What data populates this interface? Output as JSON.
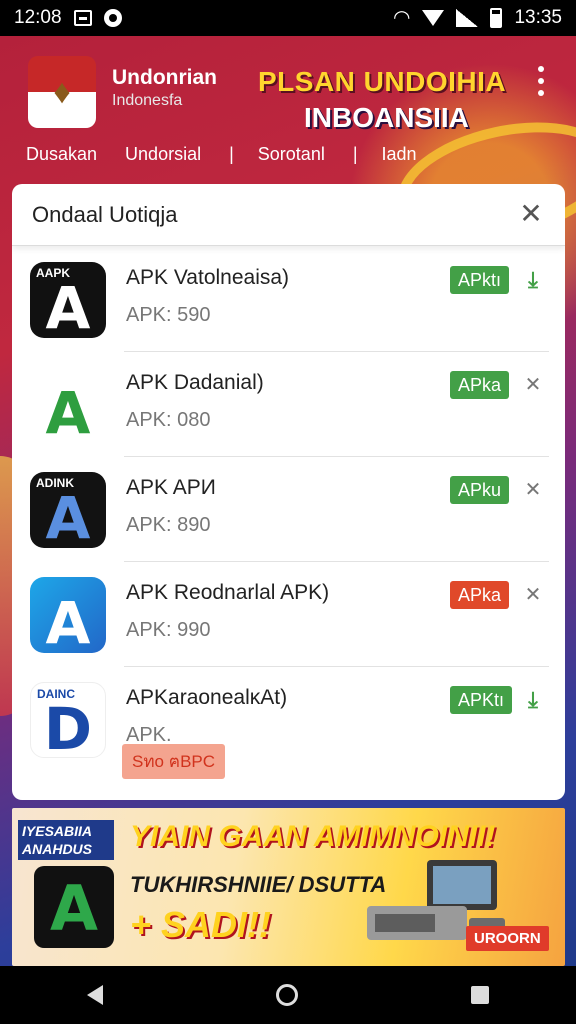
{
  "status_bar": {
    "time_left": "12:08",
    "time_right": "13:35"
  },
  "header": {
    "brand_name": "Undonrian",
    "brand_sub": "Indonesfa",
    "hero_title": "PLSAN UNDOIHIA",
    "hero_title2": "INBOANSIIA",
    "nav_tabs": [
      "Dusakan",
      "Undorsial",
      "Sorotanl",
      "Iadn"
    ],
    "nav_separator": "|"
  },
  "sheet": {
    "title": "Ondaal Uotiqja",
    "close_label": "✕",
    "items": [
      {
        "name": "APK Vatolneaisa)",
        "size": "APK: 590",
        "badge": "APktı",
        "badge_color": "#43a047",
        "action": "download-icon",
        "icon_tag": "AAPK"
      },
      {
        "name": "APK Dadanial)",
        "size": "APK: 080",
        "badge": "APka",
        "badge_color": "#43a047",
        "action": "x-icon",
        "icon_tag": ""
      },
      {
        "name": "APK APИ",
        "size": "APK: 890",
        "badge": "APku",
        "badge_color": "#43a047",
        "action": "x-icon",
        "icon_tag": "ADINK"
      },
      {
        "name": "APK Reodnarlal APK)",
        "size": "APK: 990",
        "badge": "APka",
        "badge_color": "#e0492a",
        "action": "x-icon",
        "icon_tag": ""
      },
      {
        "name": "APKaraonealκAt)",
        "size": "APK.",
        "badge": "APKtı",
        "badge_color": "#43a047",
        "action": "download-icon",
        "icon_tag": "DAINC",
        "chip": "Sทo ฅBPC"
      }
    ]
  },
  "banner": {
    "tag": "IYESABIIA ANAHDUS",
    "headline": "YIAIN GAAN AMIMNOINII!",
    "sub": "TUKHIRSHNIIE/ DSUTTA",
    "plus": "+ SADI!!",
    "button": "UROORN"
  },
  "colors": {
    "accent_green": "#43a047",
    "accent_red": "#e0492a",
    "hero_yellow": "#ffd52e"
  }
}
